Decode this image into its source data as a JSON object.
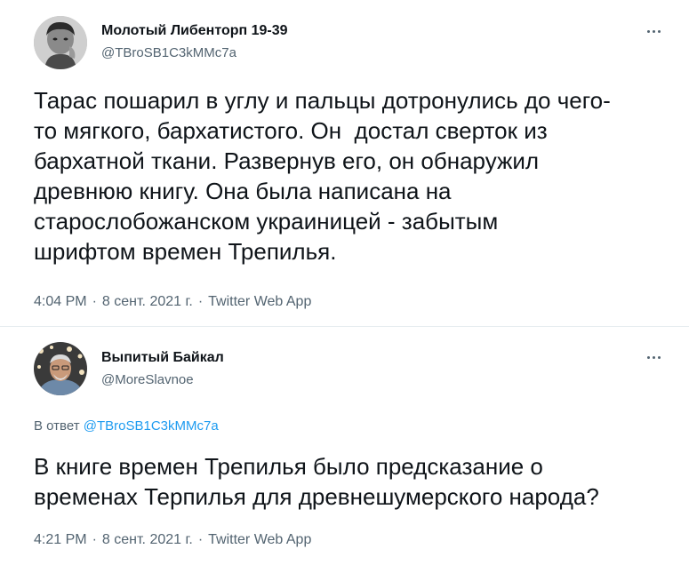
{
  "tweets": [
    {
      "name": "Молотый Либенторп 19-39",
      "handle": "@TBroSB1C3kMMc7a",
      "text": "Тарас пошарил в углу и пальцы дотронулись до чего-\nто мягкого, бархатистого. Он  достал сверток из\nбархатной ткани. Развернув его, он обнаружил\nдревнюю книгу. Она была написана на\nстарослобожанском украиницей - забытым\nшрифтом времен Трепилья.",
      "time": "4:04 PM",
      "date": "8 сент. 2021 г.",
      "source": "Twitter Web App"
    },
    {
      "name": "Выпитый Байкал",
      "handle": "@MoreSlavnoe",
      "reply_prefix": "В ответ",
      "reply_to": "@TBroSB1C3kMMc7a",
      "text": "В книге времен Трепилья было предсказание о\nвременах Терпилья для древнешумерского народа?",
      "time": "4:21 PM",
      "date": "8 сент. 2021 г.",
      "source": "Twitter Web App"
    }
  ],
  "separator": "·",
  "icons": {
    "more": "more-horizontal-icon",
    "avatar1": "bw-portrait-photo",
    "avatar2": "man-photo"
  },
  "colors": {
    "text": "#0f1419",
    "muted": "#536471",
    "link": "#1d9bf0",
    "divider": "#e6ecf0"
  }
}
